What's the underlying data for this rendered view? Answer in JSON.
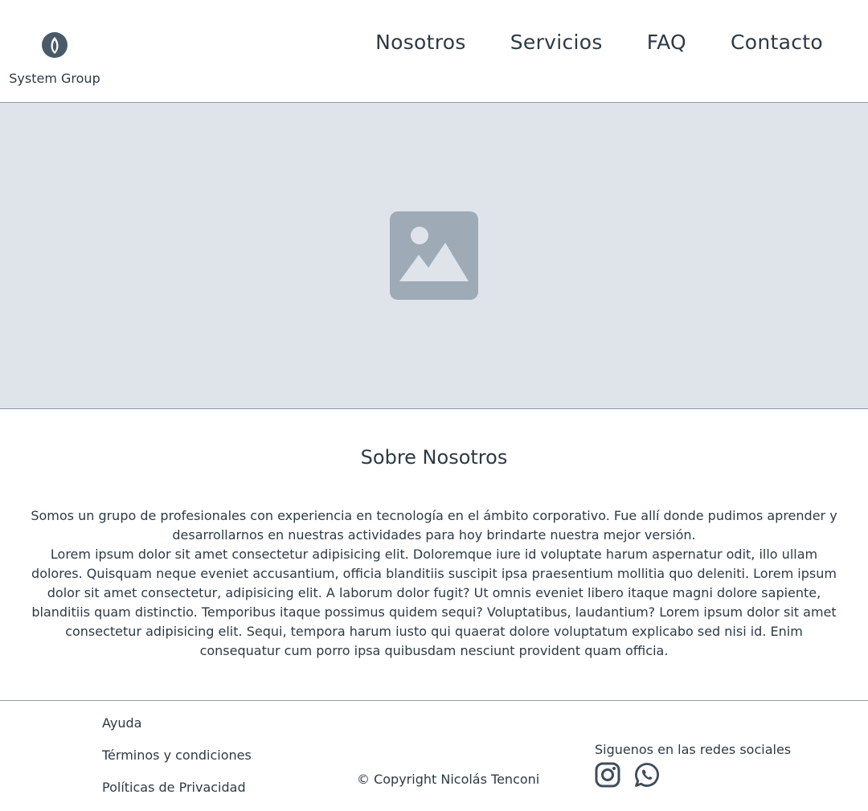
{
  "brand": {
    "name": "System Group"
  },
  "nav": {
    "items": [
      {
        "label": "Nosotros"
      },
      {
        "label": "Servicios"
      },
      {
        "label": "FAQ"
      },
      {
        "label": "Contacto"
      }
    ]
  },
  "hero": {
    "icon": "image-placeholder-icon"
  },
  "about": {
    "title": "Sobre Nosotros",
    "paragraph1": "Somos un grupo de profesionales con experiencia en tecnología en el ámbito corporativo. Fue allí donde pudimos aprender y desarrollarnos en nuestras actividades para hoy brindarte nuestra mejor versión.",
    "paragraph2": "Lorem ipsum dolor sit amet consectetur adipisicing elit. Doloremque iure id voluptate harum aspernatur odit, illo ullam dolores. Quisquam neque eveniet accusantium, officia blanditiis suscipit ipsa praesentium mollitia quo deleniti. Lorem ipsum dolor sit amet consectetur, adipisicing elit. A laborum dolor fugit? Ut omnis eveniet libero itaque magni dolore sapiente, blanditiis quam distinctio. Temporibus itaque possimus quidem sequi? Voluptatibus, laudantium? Lorem ipsum dolor sit amet consectetur adipisicing elit. Sequi, tempora harum iusto qui quaerat dolore voluptatum explicabo sed nisi id. Enim consequatur cum porro ipsa quibusdam nesciunt provident quam officia."
  },
  "footer": {
    "links": [
      {
        "label": "Ayuda"
      },
      {
        "label": "Términos y condiciones"
      },
      {
        "label": "Políticas de Privacidad"
      }
    ],
    "copyright": "© Copyright Nicolás Tenconi",
    "social_title": "Siguenos en las redes sociales",
    "social_icons": [
      "instagram-icon",
      "whatsapp-icon"
    ]
  },
  "colors": {
    "text": "#2d3a45",
    "hero_bg": "#dfe4eb",
    "icon_gray": "#9eabb7",
    "divider": "#8e9aa5"
  }
}
